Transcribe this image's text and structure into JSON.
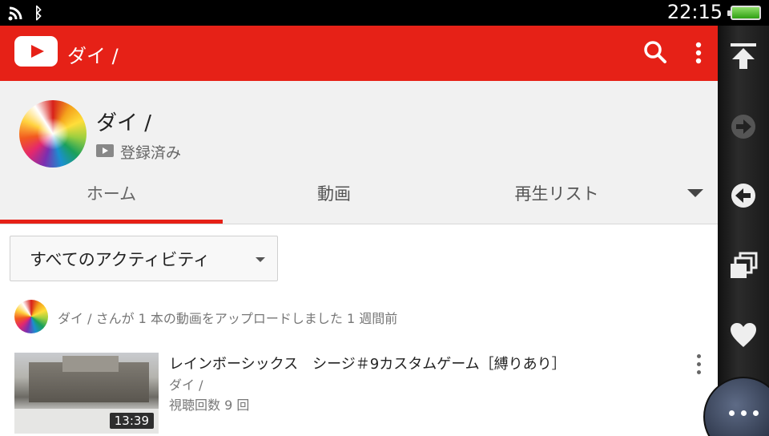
{
  "status_bar": {
    "time": "22:15",
    "icons": [
      "wifi-icon",
      "bluetooth-icon",
      "battery-icon"
    ]
  },
  "app_bar": {
    "title": "ダイ /",
    "logo": "youtube-logo-icon",
    "actions": [
      "search-icon",
      "more-vert-icon"
    ],
    "accent_color": "#e62117"
  },
  "channel": {
    "name": "ダイ /",
    "subscribed_label": "登録済み"
  },
  "tabs": [
    {
      "label": "ホーム",
      "active": true
    },
    {
      "label": "動画",
      "active": false
    },
    {
      "label": "再生リスト",
      "active": false
    }
  ],
  "filter": {
    "selected": "すべてのアクティビティ"
  },
  "activity": {
    "text": "ダイ / さんが 1 本の動画をアップロードしました 1 週間前"
  },
  "video": {
    "title": "レインボーシックス　シージ＃9カスタムゲーム［縛りあり］",
    "channel": "ダイ /",
    "views": "視聴回数 9 回",
    "duration": "13:39"
  },
  "system_bar": {
    "buttons": [
      "scroll-top-icon",
      "forward-icon",
      "back-icon",
      "windows-icon",
      "favorite-icon",
      "menu-icon"
    ]
  }
}
